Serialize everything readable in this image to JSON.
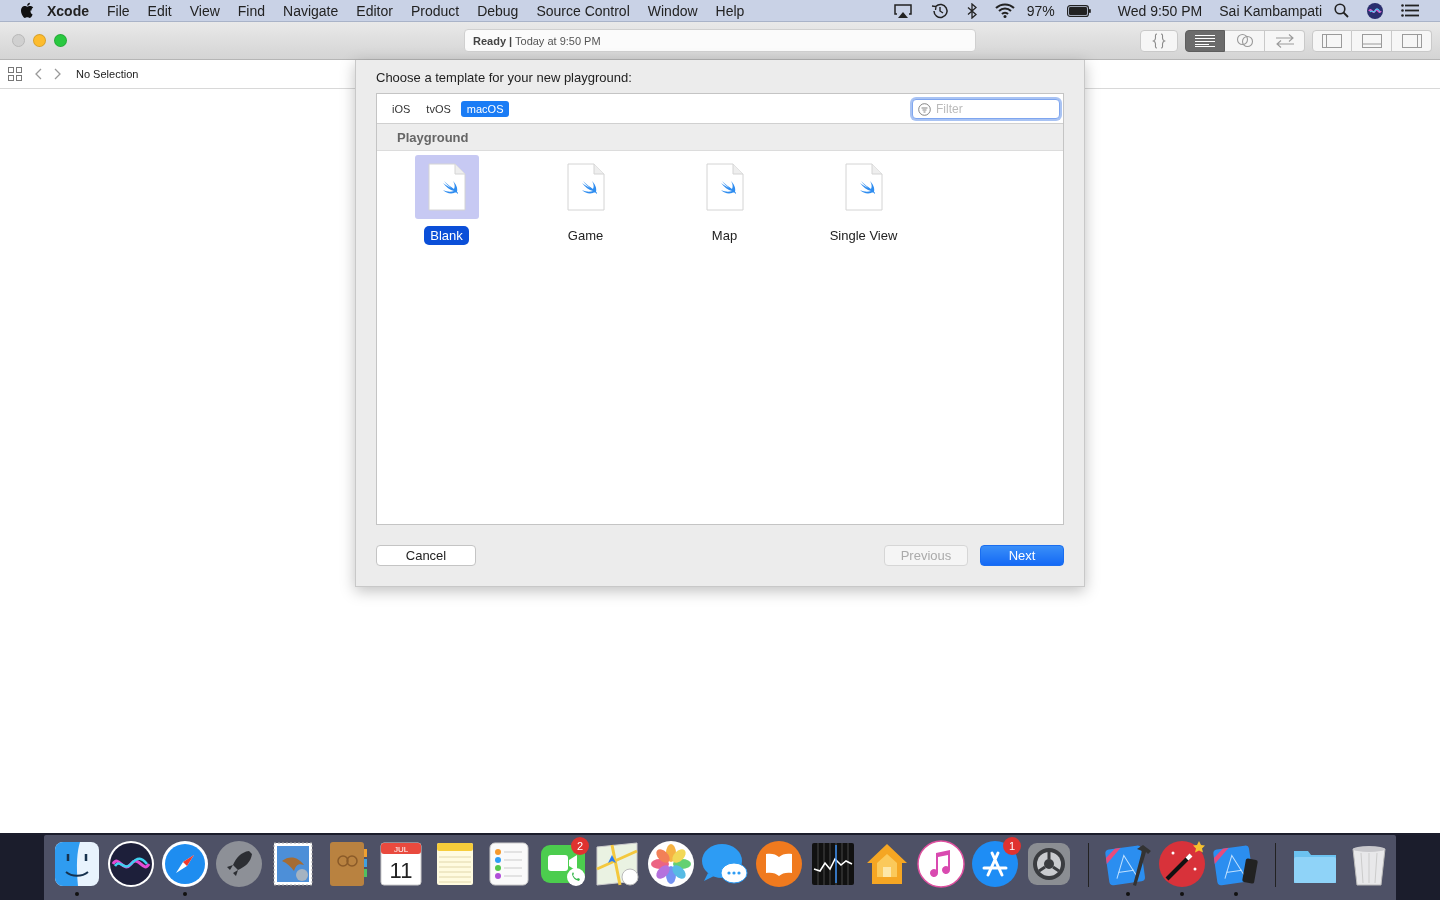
{
  "menu_bar": {
    "app_name": "Xcode",
    "menus": [
      "File",
      "Edit",
      "View",
      "Find",
      "Navigate",
      "Editor",
      "Product",
      "Debug",
      "Source Control",
      "Window",
      "Help"
    ],
    "battery": "97%",
    "clock": "Wed 9:50 PM",
    "user": "Sai Kambampati"
  },
  "window": {
    "traffic_lights": [
      {
        "kind": "close",
        "disabled": true
      },
      {
        "kind": "minimize",
        "disabled": false
      },
      {
        "kind": "zoom",
        "disabled": false
      }
    ],
    "status": "**Ready |** Today at 9:50 PM",
    "editor_modes": [
      {
        "kind": "standard",
        "selected": true
      },
      {
        "kind": "assistant",
        "selected": false
      },
      {
        "kind": "version",
        "selected": false
      }
    ],
    "panel_toggles": [
      {
        "kind": "left"
      },
      {
        "kind": "bottom"
      },
      {
        "kind": "right"
      }
    ],
    "jump_bar": {
      "label": "No Selection"
    }
  },
  "sheet": {
    "title": "Choose a template for your new playground:",
    "platforms": [
      {
        "label": "iOS",
        "selected": false
      },
      {
        "label": "tvOS",
        "selected": false
      },
      {
        "label": "macOS",
        "selected": true
      }
    ],
    "filter": {
      "placeholder": "Filter"
    },
    "section": "Playground",
    "templates": [
      {
        "label": "Blank",
        "selected": true
      },
      {
        "label": "Game",
        "selected": false
      },
      {
        "label": "Map",
        "selected": false
      },
      {
        "label": "Single View",
        "selected": false
      }
    ],
    "buttons": [
      {
        "label": "Cancel",
        "kind": "normal",
        "disabled": false
      },
      {
        "label": "Previous",
        "kind": "normal",
        "disabled": true
      },
      {
        "label": "Next",
        "kind": "default",
        "disabled": false
      }
    ]
  },
  "dock": {
    "groups": [
      [
        {
          "kind": "finder",
          "running": true
        },
        {
          "kind": "siri",
          "running": false
        },
        {
          "kind": "safari",
          "running": true
        },
        {
          "kind": "launchpad",
          "running": false
        },
        {
          "kind": "mail",
          "running": false
        },
        {
          "kind": "contacts",
          "running": false
        },
        {
          "kind": "calendar",
          "running": false,
          "month": "JUL",
          "day": "11"
        },
        {
          "kind": "notes",
          "running": false
        },
        {
          "kind": "reminders",
          "running": false
        },
        {
          "kind": "facetime",
          "running": false,
          "badge": "2"
        },
        {
          "kind": "maps",
          "running": false
        },
        {
          "kind": "photos",
          "running": false
        },
        {
          "kind": "messages",
          "running": false
        },
        {
          "kind": "books",
          "running": false
        },
        {
          "kind": "stocks",
          "running": false
        },
        {
          "kind": "home",
          "running": false
        },
        {
          "kind": "music",
          "running": false
        },
        {
          "kind": "appstore",
          "running": false,
          "badge": "1"
        },
        {
          "kind": "preferences",
          "running": false
        }
      ],
      [
        {
          "kind": "xcode",
          "running": true
        },
        {
          "kind": "wand",
          "running": true
        },
        {
          "kind": "simulator",
          "running": true
        }
      ],
      [
        {
          "kind": "folder",
          "running": false
        },
        {
          "kind": "trash",
          "running": false
        }
      ]
    ]
  }
}
